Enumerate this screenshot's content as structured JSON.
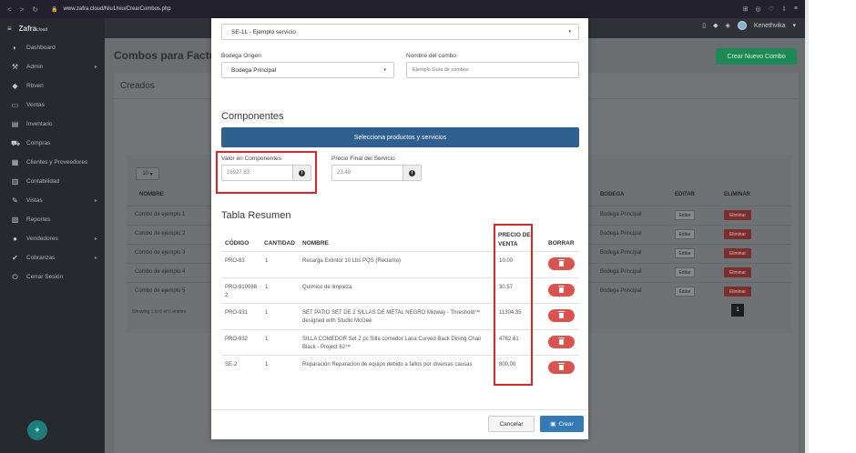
{
  "browser": {
    "url": "www.zafra.cloud/Niu1/niu/CrearCombos.php",
    "nav_icons": [
      "back-icon",
      "forward-icon",
      "reload-icon"
    ]
  },
  "sidebar": {
    "logo": "Zafra",
    "logo_suffix": "cloud",
    "items": [
      {
        "label": "Dashboard",
        "icon": "dashboard-icon"
      },
      {
        "label": "Admin",
        "icon": "wrench-icon",
        "chevron": true
      },
      {
        "label": "Rbven",
        "icon": "tag-icon"
      },
      {
        "label": "Ventas",
        "icon": "money-icon"
      },
      {
        "label": "Inventario",
        "icon": "box-icon"
      },
      {
        "label": "Compras",
        "icon": "cart-icon"
      },
      {
        "label": "Clientes y Proveedores",
        "icon": "list-icon"
      },
      {
        "label": "Contabilidad",
        "icon": "doc-icon"
      },
      {
        "label": "Vistas",
        "icon": "edit-icon",
        "chevron": true
      },
      {
        "label": "Reportes",
        "icon": "report-icon"
      },
      {
        "label": "Vendedores",
        "icon": "user-icon",
        "chevron": true
      },
      {
        "label": "Cobranzas",
        "icon": "check-icon",
        "chevron": true
      },
      {
        "label": "Cerrar Sesión",
        "icon": "power-icon"
      }
    ]
  },
  "topbar": {
    "user": "Kenethvika"
  },
  "page": {
    "title": "Combos para Facturac",
    "create_button": "Crear Nuevo Combo",
    "panel_title": "Creados",
    "page_size": "10",
    "columns": [
      "NOMBRE",
      "BODEGA",
      "EDITAR",
      "ELIMINAR"
    ],
    "rows": [
      {
        "nombre": "Combo de ejemplo 1",
        "bodega": "Bodega Principal"
      },
      {
        "nombre": "Combo de ejemplo 2",
        "bodega": "Bodega Principal"
      },
      {
        "nombre": "Combo de ejemplo 3",
        "bodega": "Bodega Principal"
      },
      {
        "nombre": "Combo de ejemplo 4",
        "bodega": "Bodega Principal"
      },
      {
        "nombre": "Combo de ejemplo 5",
        "bodega": "Bodega Principal"
      }
    ],
    "edit_label": "Editar",
    "delete_label": "Eliminar",
    "showing": "Showing 1 to 6 of 6 entries",
    "current_page": "1"
  },
  "modal": {
    "service_select": "SE-1L - Ejemplo servicio",
    "bodega_label": "Bodega Origen",
    "bodega_value": "Bodega Principal",
    "nombre_label": "Nombre del combo",
    "nombre_placeholder": "Ejemplo Guía de combos",
    "components_title": "Componentes",
    "select_products_button": "Selecciona productos y servicios",
    "valor_label": "Valor en Componentes",
    "valor_value": "16927.83",
    "precio_label": "Precio Final del Servicio",
    "precio_value": "23.49",
    "summary_title": "Tabla Resumen",
    "table_headers": {
      "codigo": "CÓDIGO",
      "cantidad": "CANTIDAD",
      "nombre": "NOMBRE",
      "precio_line1": "PRECIO DE",
      "precio_line2": "VENTA",
      "borrar": "BORRAR"
    },
    "items": [
      {
        "codigo": "PRO-83",
        "cantidad": "1",
        "nombre": "Recarga Extintor 10 Lbs PQS (Reclamo)",
        "precio": "10.00"
      },
      {
        "codigo": "PRO-9100882",
        "cantidad": "1",
        "nombre": "Químico de limpieza",
        "precio": "30.57"
      },
      {
        "codigo": "PRO-931",
        "cantidad": "1",
        "nombre": "SET PATIO SET DE 2 SILLAS DE METAL NEGRO Midway - Threshold™ designed with Studio McGee",
        "precio": "11304.35"
      },
      {
        "codigo": "PRO-932",
        "cantidad": "1",
        "nombre": "SILLA COMEDOR Set 2 pc Silla comedor Lana Curved Back Dining Chair Black - Project 62™",
        "precio": "4782.61"
      },
      {
        "codigo": "SE-2",
        "cantidad": "1",
        "nombre": "Reparación Reparacion de equipo debido a fallos por diversas causas",
        "precio": "800.00"
      }
    ],
    "cancel_button": "Cancelar",
    "create_button": "Crear"
  }
}
